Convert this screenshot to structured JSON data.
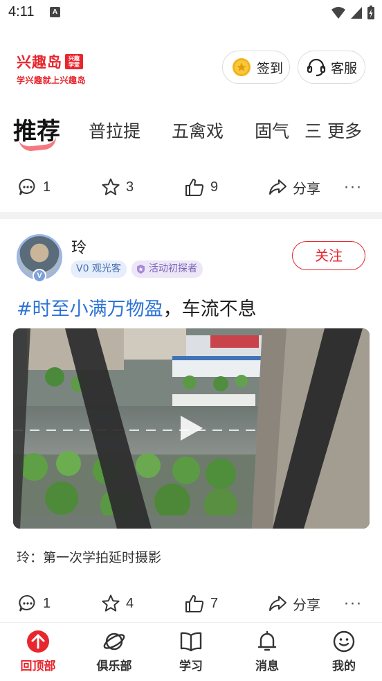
{
  "status_bar": {
    "time": "4:11",
    "notification_letter": "A"
  },
  "header": {
    "logo_name": "兴趣岛",
    "logo_badge": "兴趣学堂",
    "logo_slogan": "学兴趣就上兴趣岛",
    "signin_label": "签到",
    "service_label": "客服"
  },
  "tabs": {
    "items": [
      "推荐",
      "普拉提",
      "五禽戏",
      "固气"
    ],
    "more_label": "三 更多",
    "active": "推荐"
  },
  "prev_post_actions": {
    "comments": "1",
    "stars": "3",
    "likes": "9",
    "share_label": "分享",
    "more": "···"
  },
  "post": {
    "username": "玲",
    "level_badge": "V0 观光客",
    "explorer_badge": "活动初探者",
    "avatar_badge": "V",
    "follow_label": "关注",
    "tag": "#时至小满万物盈",
    "title_rest": "，车流不息",
    "caption": "玲：第一次学拍延时摄影",
    "actions": {
      "comments": "1",
      "stars": "4",
      "likes": "7",
      "share_label": "分享",
      "more": "···"
    }
  },
  "bottom_nav": {
    "items": [
      {
        "label": "回顶部",
        "icon": "arrow-up-icon",
        "active": true
      },
      {
        "label": "俱乐部",
        "icon": "planet-icon",
        "active": false
      },
      {
        "label": "学习",
        "icon": "book-icon",
        "active": false
      },
      {
        "label": "消息",
        "icon": "bell-icon",
        "active": false
      },
      {
        "label": "我的",
        "icon": "smiley-icon",
        "active": false
      }
    ]
  },
  "colors": {
    "brand_red": "#e8262d",
    "tag_blue": "#2d73d6",
    "gold": "#f3b21a"
  }
}
